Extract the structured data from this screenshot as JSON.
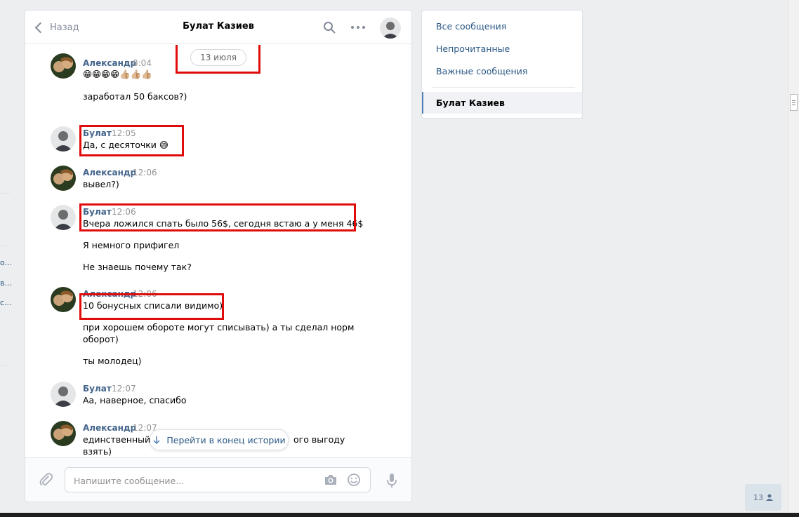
{
  "left_fragments": [
    "о...",
    "в...",
    "с..."
  ],
  "header": {
    "back_label": "Назад",
    "title": "Булат Казиев"
  },
  "history": {
    "date": "13 июля",
    "messages": [
      {
        "author": "Александр",
        "time": "8:04",
        "lines": [
          "😁😁😁😁👍🏼👍🏼👍🏼",
          "заработал 50 баксов?)"
        ]
      },
      {
        "author": "Булат",
        "time": "12:05",
        "lines": [
          "Да, с десяточки 😅"
        ]
      },
      {
        "author": "Александр",
        "time": "12:06",
        "lines": [
          "вывел?)"
        ]
      },
      {
        "author": "Булат",
        "time": "12:06",
        "lines": [
          "Вчера ложился спать было 56$, сегодня встаю а у меня 46$",
          "Я немного прифигел",
          "Не знаешь почему так?"
        ]
      },
      {
        "author": "Александр",
        "time": "12:06",
        "lines": [
          "10 бонусных списали видимо)",
          "при хорошем обороте могут списывать) а ты сделал норм",
          "оборот)",
          "ты молодец)"
        ]
      },
      {
        "author": "Булат",
        "time": "12:07",
        "lines": [
          "Аа, наверное, спасибо"
        ]
      },
      {
        "author": "Александр",
        "time": "12:07",
        "lines": [
          "единственный п",
          "ого выгоду",
          "взять)"
        ]
      }
    ],
    "goto_end_label": "Перейти в конец истории"
  },
  "composer": {
    "placeholder": "Напишите сообщение..."
  },
  "side": {
    "items": [
      "Все сообщения",
      "Непрочитанные",
      "Важные сообщения"
    ],
    "active": "Булат Казиев"
  },
  "counter": "13",
  "colors": {
    "link": "#2a5885",
    "author": "#42648b",
    "highlight": "#e00b0b",
    "background": "#edeef0"
  }
}
